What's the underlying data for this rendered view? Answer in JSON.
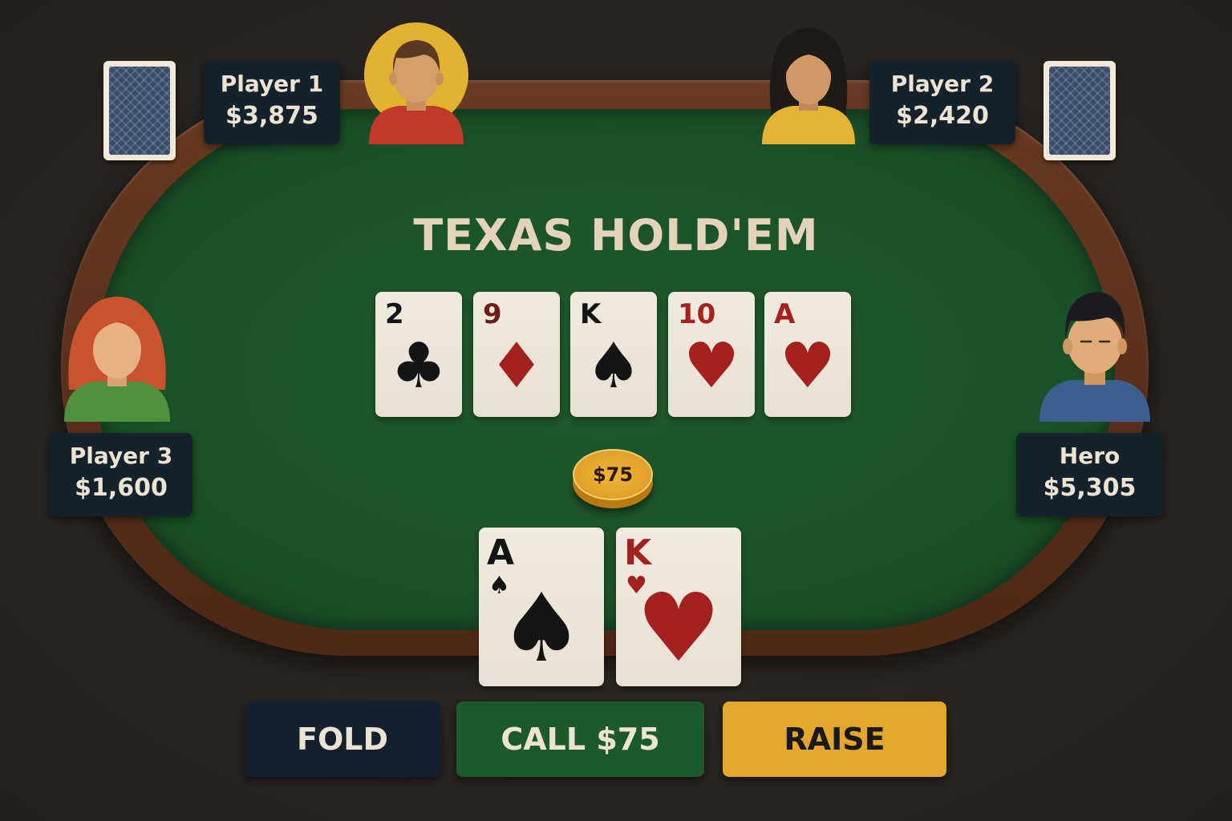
{
  "game": {
    "title": "TEXAS HOLD'EM"
  },
  "board": [
    {
      "rank": "2",
      "suit": "♣",
      "suit_name": "clubs",
      "color": "#141414"
    },
    {
      "rank": "9",
      "suit": "♦",
      "suit_name": "diamonds",
      "color": "#a3211e"
    },
    {
      "rank": "K",
      "suit": "♠",
      "suit_name": "spades",
      "color": "#141414"
    },
    {
      "rank": "10",
      "suit": "♥",
      "suit_name": "hearts",
      "color": "#a3211e"
    },
    {
      "rank": "A",
      "suit": "♥",
      "suit_name": "hearts",
      "color": "#a3211e"
    }
  ],
  "hero_hand": [
    {
      "rank": "A",
      "suit": "♠",
      "suit_name": "spades",
      "color": "#141414"
    },
    {
      "rank": "K",
      "suit": "♥",
      "suit_name": "hearts",
      "color": "#a3211e"
    }
  ],
  "pot": {
    "amount": "$75"
  },
  "players": {
    "p1": {
      "name": "Player 1",
      "chips": "$3,875"
    },
    "p2": {
      "name": "Player 2",
      "chips": "$2,420"
    },
    "p3": {
      "name": "Player 3",
      "chips": "$1,600"
    },
    "hero": {
      "name": "Hero",
      "chips": "$5,305"
    }
  },
  "actions": {
    "fold": "FOLD",
    "call": "CALL $75",
    "raise": "RAISE"
  },
  "colors": {
    "felt": "#1b5128",
    "rim": "#5a301b",
    "plate": "#14222c",
    "fold": "#13222c",
    "call": "#1d5a2b",
    "raise": "#e2a72c",
    "chip": "#e0a02a"
  }
}
